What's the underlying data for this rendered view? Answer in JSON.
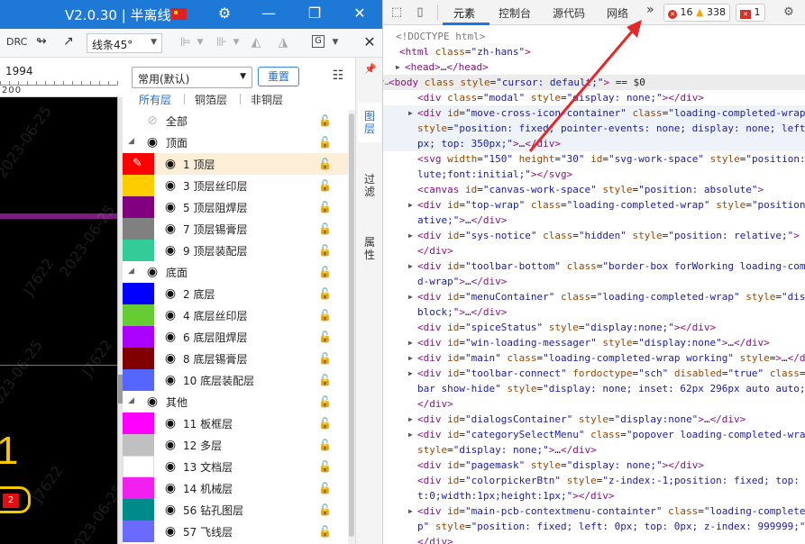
{
  "app": {
    "title": "V2.0.30 | 半离线",
    "toolbar": {
      "drc": "DRC",
      "line_style": "线条45°"
    },
    "ruler": {
      "label1": "1994",
      "label2": "200"
    },
    "canvas": {
      "watermarks": [
        "2023-06-25",
        "2023-06-25",
        "J7622",
        "J7622",
        "2023-06-25",
        "J7622",
        "2023-06-25"
      ],
      "yellow_text": "1",
      "badge": "2"
    }
  },
  "layer_panel": {
    "preset": "常用(默认)",
    "reset_label": "重置",
    "tabs": [
      "所有层",
      "铜箔层",
      "非铜层"
    ],
    "rows": [
      {
        "type": "all",
        "label": "全部",
        "color": ""
      },
      {
        "type": "group",
        "label": "顶面",
        "color": ""
      },
      {
        "type": "layer",
        "label": "1 顶层",
        "color": "#ff0000",
        "selected": true,
        "pencil": true
      },
      {
        "type": "layer",
        "label": "3 顶层丝印层",
        "color": "#ffcc00"
      },
      {
        "type": "layer",
        "label": "5 顶层阻焊层",
        "color": "#800080"
      },
      {
        "type": "layer",
        "label": "7 顶层锡膏层",
        "color": "#808080"
      },
      {
        "type": "layer",
        "label": "9 顶层装配层",
        "color": "#33cc99"
      },
      {
        "type": "group",
        "label": "底面",
        "color": ""
      },
      {
        "type": "layer",
        "label": "2 底层",
        "color": "#0000ff"
      },
      {
        "type": "layer",
        "label": "4 底层丝印层",
        "color": "#66cc33"
      },
      {
        "type": "layer",
        "label": "6 底层阻焊层",
        "color": "#aa00ff"
      },
      {
        "type": "layer",
        "label": "8 底层锡膏层",
        "color": "#800000"
      },
      {
        "type": "layer",
        "label": "10 底层装配层",
        "color": "#5566ff"
      },
      {
        "type": "group",
        "label": "其他",
        "color": ""
      },
      {
        "type": "layer",
        "label": "11 板框层",
        "color": "#ff00ff"
      },
      {
        "type": "layer",
        "label": "12 多层",
        "color": "#c0c0c0"
      },
      {
        "type": "layer",
        "label": "13 文档层",
        "color": "#ffffff"
      },
      {
        "type": "layer",
        "label": "14 机械层",
        "color": "#f020f0"
      },
      {
        "type": "layer",
        "label": "56 钻孔图层",
        "color": "#008b8b"
      },
      {
        "type": "layer",
        "label": "57 飞线层",
        "color": "#6a6aff",
        "lock_blue": true
      }
    ],
    "side_tabs": [
      "图层",
      "过滤",
      "属性"
    ]
  },
  "devtools": {
    "tabs": [
      "元素",
      "控制台",
      "源代码",
      "网络"
    ],
    "more": "»",
    "errors": "16",
    "warnings": "338",
    "messages": "1",
    "lines": [
      [
        [
          "cm",
          "<!DOCTYPE html>"
        ]
      ],
      [
        [
          "tg",
          "<html "
        ],
        [
          "at",
          "class"
        ],
        [
          "tx",
          "="
        ],
        [
          "av",
          "\"zh-hans\""
        ],
        [
          "tg",
          ">"
        ]
      ],
      [
        [
          "tg",
          "<head>"
        ],
        [
          "tx",
          "…"
        ],
        [
          "tg",
          "</head>"
        ]
      ],
      [
        [
          "tg",
          "<body "
        ],
        [
          "at",
          "class"
        ],
        [
          "tx",
          " "
        ],
        [
          "at",
          "style"
        ],
        [
          "tx",
          "="
        ],
        [
          "av",
          "\"cursor: default;\""
        ],
        [
          "tg",
          ">"
        ],
        [
          "tx",
          " == $0"
        ]
      ],
      [
        [
          "tg",
          "<div "
        ],
        [
          "at",
          "class"
        ],
        [
          "tx",
          "="
        ],
        [
          "av",
          "\"modal\""
        ],
        [
          "tx",
          " "
        ],
        [
          "at",
          "style"
        ],
        [
          "tx",
          "="
        ],
        [
          "av",
          "\"display: none;\""
        ],
        [
          "tg",
          "></div>"
        ]
      ],
      [
        [
          "tg",
          "<div "
        ],
        [
          "at",
          "id"
        ],
        [
          "tx",
          "="
        ],
        [
          "av",
          "\"move-cross-icon-container\""
        ],
        [
          "tx",
          " "
        ],
        [
          "at",
          "class"
        ],
        [
          "tx",
          "="
        ],
        [
          "av",
          "\"loading-completed-wrap\""
        ]
      ],
      [
        [
          "at",
          "style"
        ],
        [
          "tx",
          "="
        ],
        [
          "av",
          "\"position: fixed; pointer-events: none; display: none; left"
        ]
      ],
      [
        [
          "av",
          "px; top: 350px;\""
        ],
        [
          "tg",
          ">"
        ],
        [
          "tx",
          "…"
        ],
        [
          "tg",
          "</div>"
        ]
      ],
      [
        [
          "tg",
          "<svg "
        ],
        [
          "at",
          "width"
        ],
        [
          "tx",
          "="
        ],
        [
          "av",
          "\"150\""
        ],
        [
          "tx",
          " "
        ],
        [
          "at",
          "height"
        ],
        [
          "tx",
          "="
        ],
        [
          "av",
          "\"30\""
        ],
        [
          "tx",
          " "
        ],
        [
          "at",
          "id"
        ],
        [
          "tx",
          "="
        ],
        [
          "av",
          "\"svg-work-space\""
        ],
        [
          "tx",
          " "
        ],
        [
          "at",
          "style"
        ],
        [
          "tx",
          "="
        ],
        [
          "av",
          "\"position:"
        ]
      ],
      [
        [
          "av",
          "lute;font:initial;\""
        ],
        [
          "tg",
          "></svg>"
        ]
      ],
      [
        [
          "tg",
          "<canvas "
        ],
        [
          "at",
          "id"
        ],
        [
          "tx",
          "="
        ],
        [
          "av",
          "\"canvas-work-space\""
        ],
        [
          "tx",
          " "
        ],
        [
          "at",
          "style"
        ],
        [
          "tx",
          "="
        ],
        [
          "av",
          "\"position: absolute\""
        ],
        [
          "tg",
          ">"
        ]
      ],
      [
        [
          "tg",
          "<div "
        ],
        [
          "at",
          "id"
        ],
        [
          "tx",
          "="
        ],
        [
          "av",
          "\"top-wrap\""
        ],
        [
          "tx",
          " "
        ],
        [
          "at",
          "class"
        ],
        [
          "tx",
          "="
        ],
        [
          "av",
          "\"loading-completed-wrap\""
        ],
        [
          "tx",
          " "
        ],
        [
          "at",
          "style"
        ],
        [
          "tx",
          "="
        ],
        [
          "av",
          "\"position"
        ]
      ],
      [
        [
          "av",
          "ative;\""
        ],
        [
          "tg",
          ">"
        ],
        [
          "tx",
          "…"
        ],
        [
          "tg",
          "</div>"
        ]
      ],
      [
        [
          "tg",
          "<div "
        ],
        [
          "at",
          "id"
        ],
        [
          "tx",
          "="
        ],
        [
          "av",
          "\"sys-notice\""
        ],
        [
          "tx",
          " "
        ],
        [
          "at",
          "class"
        ],
        [
          "tx",
          "="
        ],
        [
          "av",
          "\"hidden\""
        ],
        [
          "tx",
          " "
        ],
        [
          "at",
          "style"
        ],
        [
          "tx",
          "="
        ],
        [
          "av",
          "\"position: relative;\""
        ],
        [
          "tg",
          ">"
        ]
      ],
      [
        [
          "tg",
          "</div>"
        ]
      ],
      [
        [
          "tg",
          "<div "
        ],
        [
          "at",
          "id"
        ],
        [
          "tx",
          "="
        ],
        [
          "av",
          "\"toolbar-bottom\""
        ],
        [
          "tx",
          " "
        ],
        [
          "at",
          "class"
        ],
        [
          "tx",
          "="
        ],
        [
          "av",
          "\"border-box forWorking loading-comp"
        ]
      ],
      [
        [
          "av",
          "d-wrap\""
        ],
        [
          "tg",
          ">"
        ],
        [
          "tx",
          "…"
        ],
        [
          "tg",
          "</div>"
        ]
      ],
      [
        [
          "tg",
          "<div "
        ],
        [
          "at",
          "id"
        ],
        [
          "tx",
          "="
        ],
        [
          "av",
          "\"menuContainer\""
        ],
        [
          "tx",
          " "
        ],
        [
          "at",
          "class"
        ],
        [
          "tx",
          "="
        ],
        [
          "av",
          "\"loading-completed-wrap\""
        ],
        [
          "tx",
          " "
        ],
        [
          "at",
          "style"
        ],
        [
          "tx",
          "="
        ],
        [
          "av",
          "\"disp"
        ]
      ],
      [
        [
          "av",
          "block;\""
        ],
        [
          "tg",
          ">"
        ],
        [
          "tx",
          "…"
        ],
        [
          "tg",
          "</div>"
        ]
      ],
      [
        [
          "tg",
          "<div "
        ],
        [
          "at",
          "id"
        ],
        [
          "tx",
          "="
        ],
        [
          "av",
          "\"spiceStatus\""
        ],
        [
          "tx",
          " "
        ],
        [
          "at",
          "style"
        ],
        [
          "tx",
          "="
        ],
        [
          "av",
          "\"display:none;\""
        ],
        [
          "tg",
          "></div>"
        ]
      ],
      [
        [
          "tg",
          "<div "
        ],
        [
          "at",
          "id"
        ],
        [
          "tx",
          "="
        ],
        [
          "av",
          "\"win-loading-messager\""
        ],
        [
          "tx",
          " "
        ],
        [
          "at",
          "style"
        ],
        [
          "tx",
          "="
        ],
        [
          "av",
          "\"display:none\""
        ],
        [
          "tg",
          ">"
        ],
        [
          "tx",
          "…"
        ],
        [
          "tg",
          "</div>"
        ]
      ],
      [
        [
          "tg",
          "<div "
        ],
        [
          "at",
          "id"
        ],
        [
          "tx",
          "="
        ],
        [
          "av",
          "\"main\""
        ],
        [
          "tx",
          " "
        ],
        [
          "at",
          "class"
        ],
        [
          "tx",
          "="
        ],
        [
          "av",
          "\"loading-completed-wrap working\""
        ],
        [
          "tx",
          " "
        ],
        [
          "at",
          "style"
        ],
        [
          "tx",
          "="
        ],
        [
          "tg",
          ">"
        ],
        [
          "tx",
          "…"
        ],
        [
          "tg",
          "</div>"
        ]
      ],
      [
        [
          "tg",
          "<div "
        ],
        [
          "at",
          "id"
        ],
        [
          "tx",
          "="
        ],
        [
          "av",
          "\"toolbar-connect\""
        ],
        [
          "tx",
          " "
        ],
        [
          "at",
          "fordoctype"
        ],
        [
          "tx",
          "="
        ],
        [
          "av",
          "\"sch\""
        ],
        [
          "tx",
          " "
        ],
        [
          "at",
          "disabled"
        ],
        [
          "tx",
          "="
        ],
        [
          "av",
          "\"true\""
        ],
        [
          "tx",
          " "
        ],
        [
          "at",
          "class"
        ],
        [
          "tx",
          "="
        ]
      ],
      [
        [
          "av",
          "bar show-hide\""
        ],
        [
          "tx",
          " "
        ],
        [
          "at",
          "style"
        ],
        [
          "tx",
          "="
        ],
        [
          "av",
          "\"display: none; inset: 62px 296px auto auto;"
        ]
      ],
      [
        [
          "tg",
          "</div>"
        ]
      ],
      [
        [
          "tg",
          "<div "
        ],
        [
          "at",
          "id"
        ],
        [
          "tx",
          "="
        ],
        [
          "av",
          "\"dialogsContainer\""
        ],
        [
          "tx",
          " "
        ],
        [
          "at",
          "style"
        ],
        [
          "tx",
          "="
        ],
        [
          "av",
          "\"display:none\""
        ],
        [
          "tg",
          ">"
        ],
        [
          "tx",
          "…"
        ],
        [
          "tg",
          "</div>"
        ]
      ],
      [
        [
          "tg",
          "<div "
        ],
        [
          "at",
          "id"
        ],
        [
          "tx",
          "="
        ],
        [
          "av",
          "\"categorySelectMenu\""
        ],
        [
          "tx",
          " "
        ],
        [
          "at",
          "class"
        ],
        [
          "tx",
          "="
        ],
        [
          "av",
          "\"popover loading-completed-wra"
        ]
      ],
      [
        [
          "at",
          "style"
        ],
        [
          "tx",
          "="
        ],
        [
          "av",
          "\"display: none;\""
        ],
        [
          "tg",
          ">"
        ],
        [
          "tx",
          "…"
        ],
        [
          "tg",
          "</div>"
        ]
      ],
      [
        [
          "tg",
          "<div "
        ],
        [
          "at",
          "id"
        ],
        [
          "tx",
          "="
        ],
        [
          "av",
          "\"pagemask\""
        ],
        [
          "tx",
          " "
        ],
        [
          "at",
          "style"
        ],
        [
          "tx",
          "="
        ],
        [
          "av",
          "\"display: none;\""
        ],
        [
          "tg",
          "></div>"
        ]
      ],
      [
        [
          "tg",
          "<div "
        ],
        [
          "at",
          "id"
        ],
        [
          "tx",
          "="
        ],
        [
          "av",
          "\"colorpickerBtn\""
        ],
        [
          "tx",
          " "
        ],
        [
          "at",
          "style"
        ],
        [
          "tx",
          "="
        ],
        [
          "av",
          "\"z-index:-1;position: fixed; top: 0"
        ]
      ],
      [
        [
          "av",
          "t:0;width:1px;height:1px;\""
        ],
        [
          "tg",
          "></div>"
        ]
      ],
      [
        [
          "tg",
          "<div "
        ],
        [
          "at",
          "id"
        ],
        [
          "tx",
          "="
        ],
        [
          "av",
          "\"main-pcb-contextmenu-containter\""
        ],
        [
          "tx",
          " "
        ],
        [
          "at",
          "class"
        ],
        [
          "tx",
          "="
        ],
        [
          "av",
          "\"loading-completed"
        ]
      ],
      [
        [
          "av",
          "p\""
        ],
        [
          "tx",
          " "
        ],
        [
          "at",
          "style"
        ],
        [
          "tx",
          "="
        ],
        [
          "av",
          "\"position: fixed; left: 0px; top: 0px; z-index: 999999;\""
        ]
      ],
      [
        [
          "tg",
          "</div>"
        ]
      ]
    ]
  }
}
